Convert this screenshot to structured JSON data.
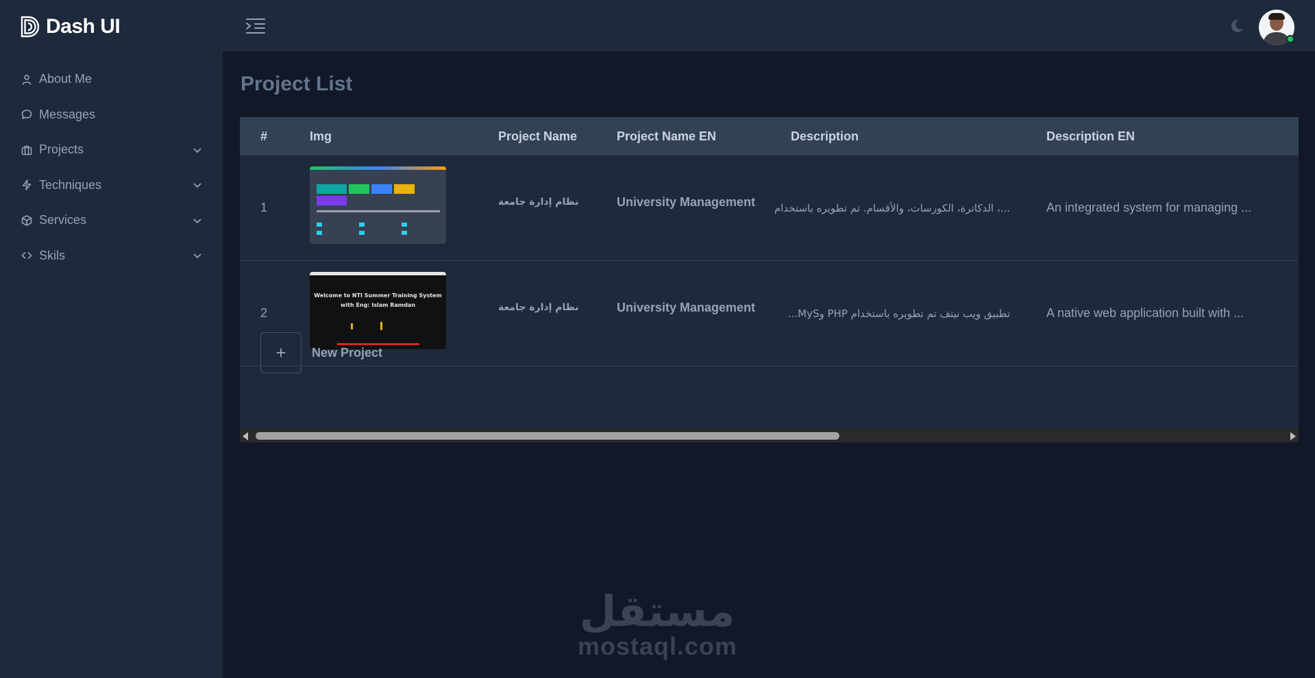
{
  "brand": {
    "name": "Dash UI"
  },
  "sidebar": {
    "items": [
      {
        "label": "About Me",
        "icon": "user-icon",
        "has_chevron": false
      },
      {
        "label": "Messages",
        "icon": "message-icon",
        "has_chevron": false
      },
      {
        "label": "Projects",
        "icon": "briefcase-icon",
        "has_chevron": true
      },
      {
        "label": "Techniques",
        "icon": "lightning-icon",
        "has_chevron": true
      },
      {
        "label": "Services",
        "icon": "box-icon",
        "has_chevron": true
      },
      {
        "label": "Skils",
        "icon": "code-icon",
        "has_chevron": true
      }
    ]
  },
  "topbar": {
    "menu_icon": "menu-toggle-icon",
    "theme_icon": "moon-icon",
    "status_color": "#22c55e"
  },
  "main": {
    "title": "Project List",
    "table": {
      "columns": [
        "#",
        "Img",
        "Project Name",
        "Project Name EN",
        "Description",
        "Description EN"
      ],
      "rows": [
        {
          "num": "1",
          "project_name": "نظام إدارة جامعة",
          "project_name_en": "University Management",
          "description": "...، الدكاترة، الكورسات، والأقسام. تم تطويره باستخدام",
          "description_en": "An integrated system for managing ..."
        },
        {
          "num": "2",
          "project_name": "نظام إدارة جامعة",
          "project_name_en": "University Management",
          "description": "تطبيق ويب نيتف تم تطويره باستخدام PHP وMyS...",
          "description_en": "A native web application built with ...",
          "thumb_text_1": "Welcome to NTI Summer Training System",
          "thumb_text_2": "with Eng: Islam Ramdan"
        }
      ]
    },
    "new_project": {
      "plus": "+",
      "label": "New Project"
    }
  },
  "watermark": {
    "ar": "مستقل",
    "en": "mostaql.com"
  },
  "colors": {
    "background": "#111827",
    "sidebar": "#1e293b",
    "table_header": "#334155"
  }
}
